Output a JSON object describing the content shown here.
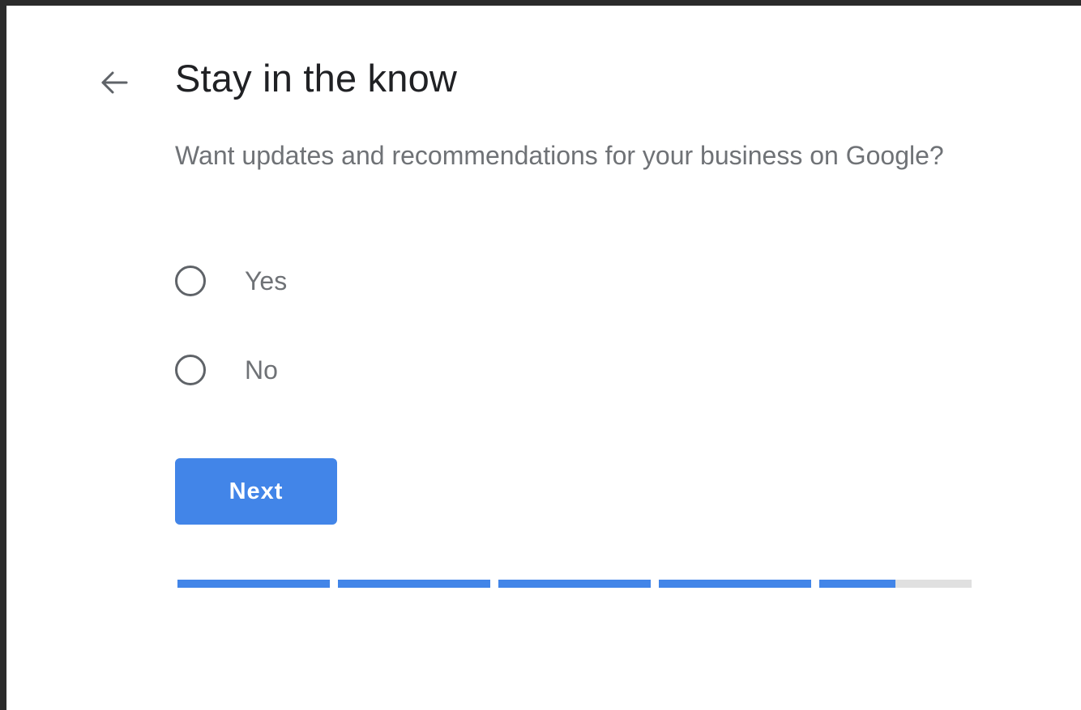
{
  "header": {
    "back_icon": "arrow-left-icon",
    "title": "Stay in the know"
  },
  "question": "Want updates and recommendations for your business on Google?",
  "options": [
    {
      "label": "Yes",
      "selected": false
    },
    {
      "label": "No",
      "selected": false
    }
  ],
  "next_label": "Next",
  "progress": {
    "segments_fill": [
      1,
      1,
      1,
      1,
      0.5
    ]
  },
  "colors": {
    "accent": "#4285e8",
    "track": "#e0e0e0",
    "title": "#202124",
    "secondary_text": "#6f7276"
  }
}
